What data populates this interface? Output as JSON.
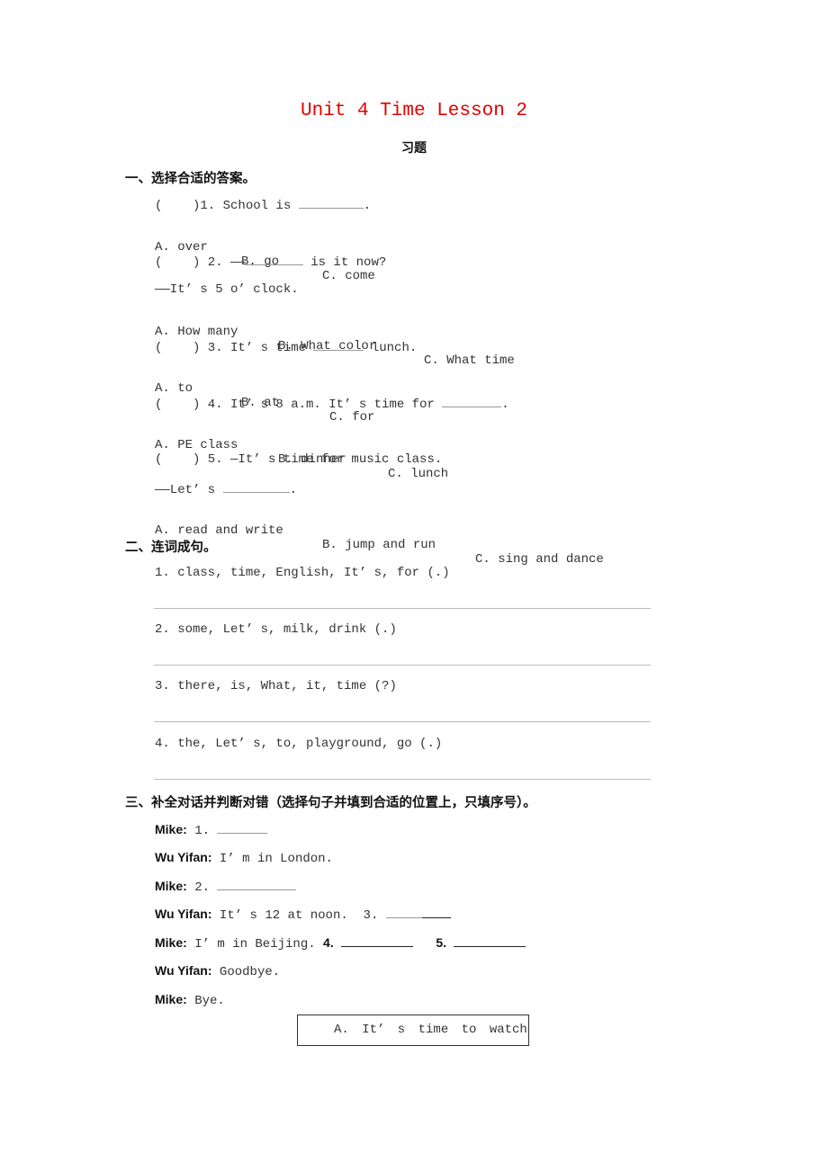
{
  "title": "Unit 4 Time Lesson 2",
  "subtitle": "习题",
  "section1": {
    "heading": "一、选择合适的答案。",
    "questions": [
      {
        "stem_prefix": "(    )1. School is ",
        "stem_suffix": ".",
        "options": [
          "A. over",
          "B. go",
          "C. come"
        ]
      },
      {
        "stem_prefix": "(    ) 2. ——",
        "stem_suffix": " is it now?",
        "reply": "——It’ s 5 o’ clock.",
        "options": [
          "A. How many",
          "B. What color",
          "C. What time"
        ]
      },
      {
        "stem_prefix": "(    ) 3. It’ s time ",
        "stem_suffix": " lunch.",
        "options": [
          "A. to",
          "B. at",
          "C. for"
        ]
      },
      {
        "stem_prefix": "(    ) 4. It’ s 8 a.m. It’ s time for ",
        "stem_suffix": ".",
        "options": [
          "A. PE class",
          "B. dinner",
          "C. lunch"
        ]
      },
      {
        "stem_prefix": "(    ) 5. —It’ s time for music class.",
        "reply_prefix": "——Let’ s ",
        "reply_suffix": ".",
        "options": [
          "A. read and write",
          "B. jump and run",
          "C. sing and dance"
        ]
      }
    ]
  },
  "section2": {
    "heading": "二、连词成句。",
    "items": [
      "1. class, time, English, It’ s, for (.)",
      "2. some, Let’ s, milk, drink (.)",
      "3. there, is, What, it, time (?)",
      "4. the, Let’ s, to, playground, go (.)"
    ]
  },
  "section3": {
    "heading": "三、补全对话并判断对错（选择句子并填到合适的位置上，只填序号）。",
    "dialogue": [
      {
        "speaker": "Mike:",
        "text": " 1. "
      },
      {
        "speaker": "Wu Yifan:",
        "text": " I’ m in London."
      },
      {
        "speaker": "Mike:",
        "text": " 2. "
      },
      {
        "speaker": "Wu Yifan:",
        "text": " It’ s 12 at noon.  3. "
      },
      {
        "speaker": "Mike:",
        "text": " I’ m in Beijing. ",
        "num4": "4.",
        "num5": "5."
      },
      {
        "speaker": "Wu Yifan:",
        "text": " Goodbye."
      },
      {
        "speaker": "Mike:",
        "text": " Bye."
      }
    ],
    "option_box_text": "A. It’ s time to watch"
  }
}
